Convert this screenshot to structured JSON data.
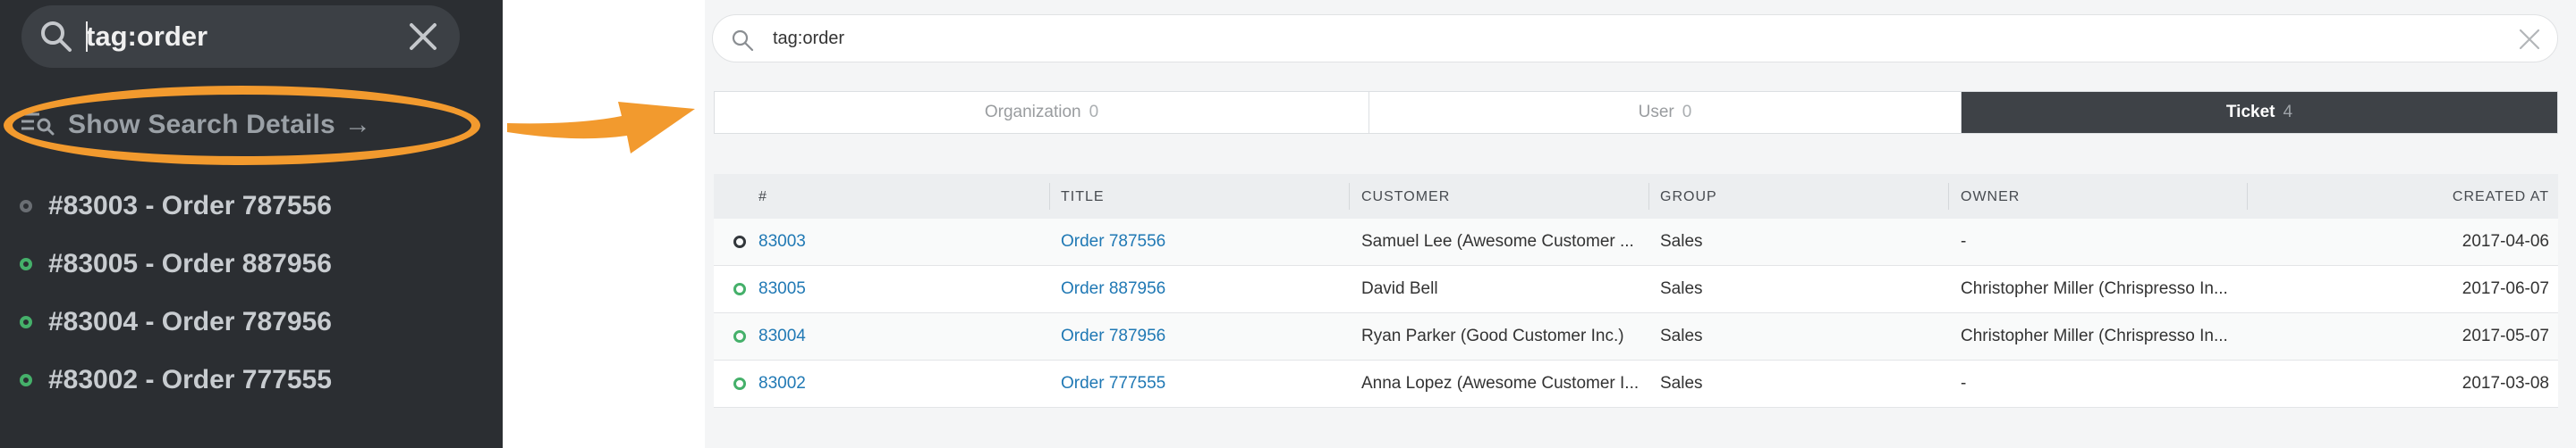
{
  "left_panel": {
    "search": {
      "query": "tag:order"
    },
    "details_link": {
      "label": "Show Search Details",
      "arrow": "→"
    },
    "results": [
      {
        "label": "#83003 - Order 787556",
        "state": "closed"
      },
      {
        "label": "#83005 - Order 887956",
        "state": "open"
      },
      {
        "label": "#83004 - Order 787956",
        "state": "open"
      },
      {
        "label": "#83002 - Order 777555",
        "state": "open"
      }
    ]
  },
  "callout": {
    "color": "#f29a2e"
  },
  "right_panel": {
    "search": {
      "query": "tag:order"
    },
    "tabs": [
      {
        "label": "Organization",
        "count": "0",
        "active": false
      },
      {
        "label": "User",
        "count": "0",
        "active": false
      },
      {
        "label": "Ticket",
        "count": "4",
        "active": true
      }
    ],
    "table": {
      "headers": {
        "number": "#",
        "title": "TITLE",
        "customer": "CUSTOMER",
        "group": "GROUP",
        "owner": "OWNER",
        "created_at": "CREATED AT"
      },
      "rows": [
        {
          "state": "closed",
          "number": "83003",
          "title": "Order 787556",
          "customer": "Samuel Lee (Awesome Customer ...",
          "group": "Sales",
          "owner": "-",
          "created_at": "2017-04-06"
        },
        {
          "state": "open",
          "number": "83005",
          "title": "Order 887956",
          "customer": "David Bell",
          "group": "Sales",
          "owner": "Christopher Miller (Chrispresso In...",
          "created_at": "2017-06-07"
        },
        {
          "state": "open",
          "number": "83004",
          "title": "Order 787956",
          "customer": "Ryan Parker (Good Customer Inc.)",
          "group": "Sales",
          "owner": "Christopher Miller (Chrispresso In...",
          "created_at": "2017-05-07"
        },
        {
          "state": "open",
          "number": "83002",
          "title": "Order 777555",
          "customer": "Anna Lopez (Awesome Customer I...",
          "group": "Sales",
          "owner": "-",
          "created_at": "2017-03-08"
        }
      ]
    }
  },
  "colors": {
    "open_state": "#45b06a",
    "closed_state": "#33373b",
    "link": "#1f78b4",
    "active_tab": "#3e4247"
  }
}
